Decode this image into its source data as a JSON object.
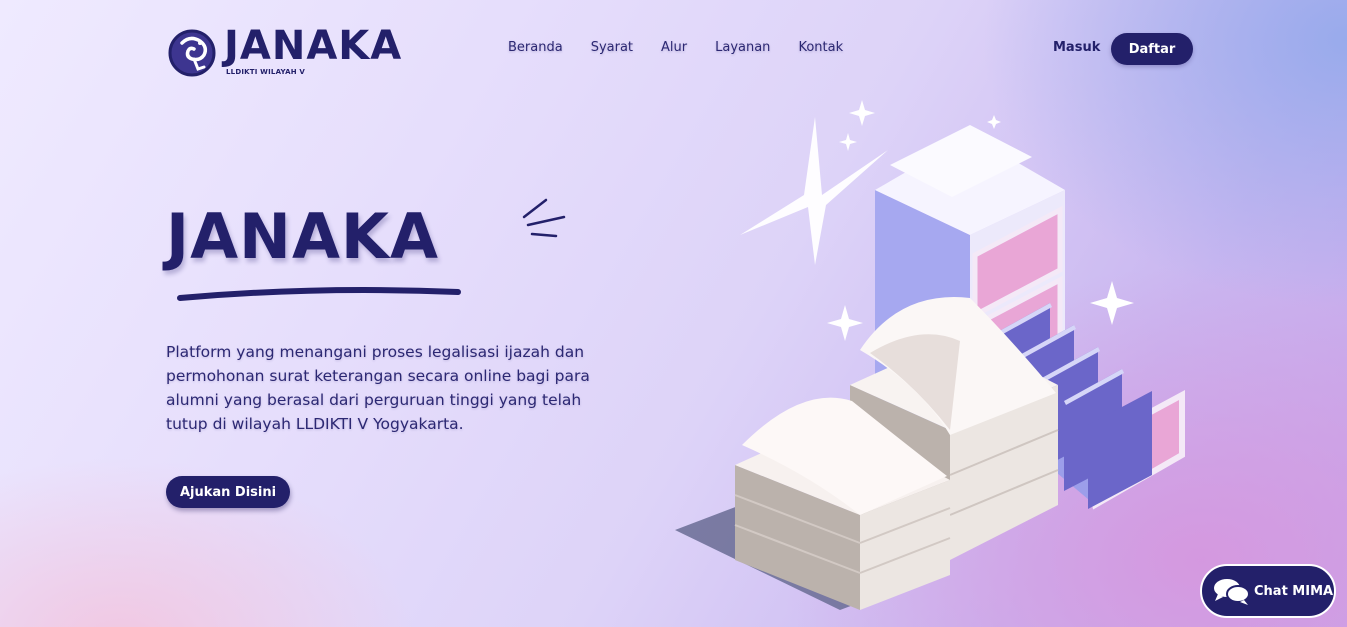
{
  "brand": {
    "name": "JANAKA",
    "subtitle": "LLDIKTI WILAYAH V"
  },
  "nav": {
    "items": [
      "Beranda",
      "Syarat",
      "Alur",
      "Layanan",
      "Kontak"
    ]
  },
  "auth": {
    "login_label": "Masuk",
    "register_label": "Daftar"
  },
  "hero": {
    "title": "JANAKA",
    "description": "Platform yang menangani proses legalisasi ijazah dan permohonan surat keterangan secara online bagi para alumni yang berasal dari perguruan tinggi yang telah tutup di wilayah LLDIKTI V Yogyakarta.",
    "cta_label": "Ajukan Disini"
  },
  "chat": {
    "label": "Chat MIMA",
    "icon": "chat-bubbles-icon"
  },
  "colors": {
    "primary": "#23206a",
    "accent_pink": "#e89ad0",
    "accent_purple": "#6b66c9"
  }
}
